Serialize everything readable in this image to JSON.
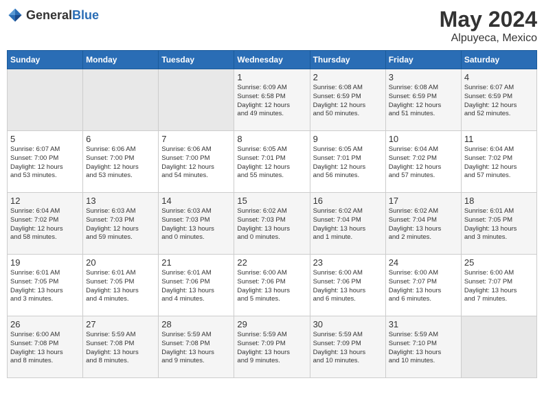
{
  "header": {
    "logo_general": "General",
    "logo_blue": "Blue",
    "month_year": "May 2024",
    "location": "Alpuyeca, Mexico"
  },
  "days_of_week": [
    "Sunday",
    "Monday",
    "Tuesday",
    "Wednesday",
    "Thursday",
    "Friday",
    "Saturday"
  ],
  "weeks": [
    [
      {
        "day": "",
        "info": ""
      },
      {
        "day": "",
        "info": ""
      },
      {
        "day": "",
        "info": ""
      },
      {
        "day": "1",
        "info": "Sunrise: 6:09 AM\nSunset: 6:58 PM\nDaylight: 12 hours\nand 49 minutes."
      },
      {
        "day": "2",
        "info": "Sunrise: 6:08 AM\nSunset: 6:59 PM\nDaylight: 12 hours\nand 50 minutes."
      },
      {
        "day": "3",
        "info": "Sunrise: 6:08 AM\nSunset: 6:59 PM\nDaylight: 12 hours\nand 51 minutes."
      },
      {
        "day": "4",
        "info": "Sunrise: 6:07 AM\nSunset: 6:59 PM\nDaylight: 12 hours\nand 52 minutes."
      }
    ],
    [
      {
        "day": "5",
        "info": "Sunrise: 6:07 AM\nSunset: 7:00 PM\nDaylight: 12 hours\nand 53 minutes."
      },
      {
        "day": "6",
        "info": "Sunrise: 6:06 AM\nSunset: 7:00 PM\nDaylight: 12 hours\nand 53 minutes."
      },
      {
        "day": "7",
        "info": "Sunrise: 6:06 AM\nSunset: 7:00 PM\nDaylight: 12 hours\nand 54 minutes."
      },
      {
        "day": "8",
        "info": "Sunrise: 6:05 AM\nSunset: 7:01 PM\nDaylight: 12 hours\nand 55 minutes."
      },
      {
        "day": "9",
        "info": "Sunrise: 6:05 AM\nSunset: 7:01 PM\nDaylight: 12 hours\nand 56 minutes."
      },
      {
        "day": "10",
        "info": "Sunrise: 6:04 AM\nSunset: 7:02 PM\nDaylight: 12 hours\nand 57 minutes."
      },
      {
        "day": "11",
        "info": "Sunrise: 6:04 AM\nSunset: 7:02 PM\nDaylight: 12 hours\nand 57 minutes."
      }
    ],
    [
      {
        "day": "12",
        "info": "Sunrise: 6:04 AM\nSunset: 7:02 PM\nDaylight: 12 hours\nand 58 minutes."
      },
      {
        "day": "13",
        "info": "Sunrise: 6:03 AM\nSunset: 7:03 PM\nDaylight: 12 hours\nand 59 minutes."
      },
      {
        "day": "14",
        "info": "Sunrise: 6:03 AM\nSunset: 7:03 PM\nDaylight: 13 hours\nand 0 minutes."
      },
      {
        "day": "15",
        "info": "Sunrise: 6:02 AM\nSunset: 7:03 PM\nDaylight: 13 hours\nand 0 minutes."
      },
      {
        "day": "16",
        "info": "Sunrise: 6:02 AM\nSunset: 7:04 PM\nDaylight: 13 hours\nand 1 minute."
      },
      {
        "day": "17",
        "info": "Sunrise: 6:02 AM\nSunset: 7:04 PM\nDaylight: 13 hours\nand 2 minutes."
      },
      {
        "day": "18",
        "info": "Sunrise: 6:01 AM\nSunset: 7:05 PM\nDaylight: 13 hours\nand 3 minutes."
      }
    ],
    [
      {
        "day": "19",
        "info": "Sunrise: 6:01 AM\nSunset: 7:05 PM\nDaylight: 13 hours\nand 3 minutes."
      },
      {
        "day": "20",
        "info": "Sunrise: 6:01 AM\nSunset: 7:05 PM\nDaylight: 13 hours\nand 4 minutes."
      },
      {
        "day": "21",
        "info": "Sunrise: 6:01 AM\nSunset: 7:06 PM\nDaylight: 13 hours\nand 4 minutes."
      },
      {
        "day": "22",
        "info": "Sunrise: 6:00 AM\nSunset: 7:06 PM\nDaylight: 13 hours\nand 5 minutes."
      },
      {
        "day": "23",
        "info": "Sunrise: 6:00 AM\nSunset: 7:06 PM\nDaylight: 13 hours\nand 6 minutes."
      },
      {
        "day": "24",
        "info": "Sunrise: 6:00 AM\nSunset: 7:07 PM\nDaylight: 13 hours\nand 6 minutes."
      },
      {
        "day": "25",
        "info": "Sunrise: 6:00 AM\nSunset: 7:07 PM\nDaylight: 13 hours\nand 7 minutes."
      }
    ],
    [
      {
        "day": "26",
        "info": "Sunrise: 6:00 AM\nSunset: 7:08 PM\nDaylight: 13 hours\nand 8 minutes."
      },
      {
        "day": "27",
        "info": "Sunrise: 5:59 AM\nSunset: 7:08 PM\nDaylight: 13 hours\nand 8 minutes."
      },
      {
        "day": "28",
        "info": "Sunrise: 5:59 AM\nSunset: 7:08 PM\nDaylight: 13 hours\nand 9 minutes."
      },
      {
        "day": "29",
        "info": "Sunrise: 5:59 AM\nSunset: 7:09 PM\nDaylight: 13 hours\nand 9 minutes."
      },
      {
        "day": "30",
        "info": "Sunrise: 5:59 AM\nSunset: 7:09 PM\nDaylight: 13 hours\nand 10 minutes."
      },
      {
        "day": "31",
        "info": "Sunrise: 5:59 AM\nSunset: 7:10 PM\nDaylight: 13 hours\nand 10 minutes."
      },
      {
        "day": "",
        "info": ""
      }
    ]
  ]
}
